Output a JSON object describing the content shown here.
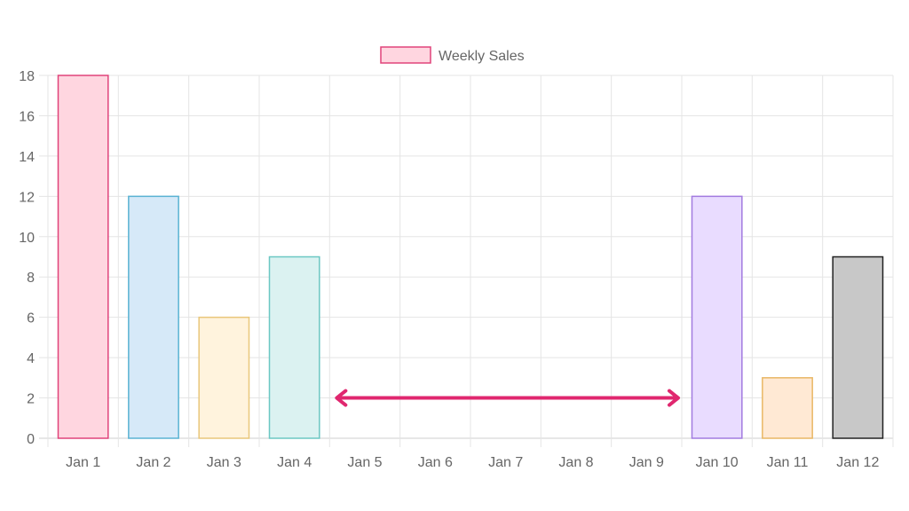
{
  "chart_data": {
    "type": "bar",
    "categories": [
      "Jan 1",
      "Jan 2",
      "Jan 3",
      "Jan 4",
      "Jan 5",
      "Jan 6",
      "Jan 7",
      "Jan 8",
      "Jan 9",
      "Jan 10",
      "Jan 11",
      "Jan 12"
    ],
    "series": [
      {
        "name": "Weekly Sales",
        "values": [
          18,
          12,
          6,
          9,
          0,
          0,
          0,
          0,
          0,
          12,
          3,
          9
        ]
      }
    ],
    "ylim": [
      0,
      18
    ],
    "y_ticks": [
      0,
      2,
      4,
      6,
      8,
      10,
      12,
      14,
      16,
      18
    ],
    "grid": true,
    "legend": "top-center",
    "bar_fill_colors": [
      "#ffd6e0",
      "#d6e9f8",
      "#fff3dd",
      "#dbf2f1",
      "#ffffff",
      "#ffffff",
      "#ffffff",
      "#ffffff",
      "#ffffff",
      "#e9dcff",
      "#ffe9d4",
      "#c8c8c8"
    ],
    "bar_border_colors": [
      "#e0437a",
      "#5ab3d3",
      "#e9c77a",
      "#6cc7c3",
      "#ffffff",
      "#ffffff",
      "#ffffff",
      "#ffffff",
      "#ffffff",
      "#a27be0",
      "#e8b765",
      "#222222"
    ],
    "legend_swatch": {
      "fill": "#ffd6e0",
      "border": "#e0437a"
    },
    "annotation_arrow": {
      "from_category": "Jan 5",
      "to_category": "Jan 9",
      "y": 2,
      "color": "#e0276f",
      "double_headed": true
    }
  }
}
